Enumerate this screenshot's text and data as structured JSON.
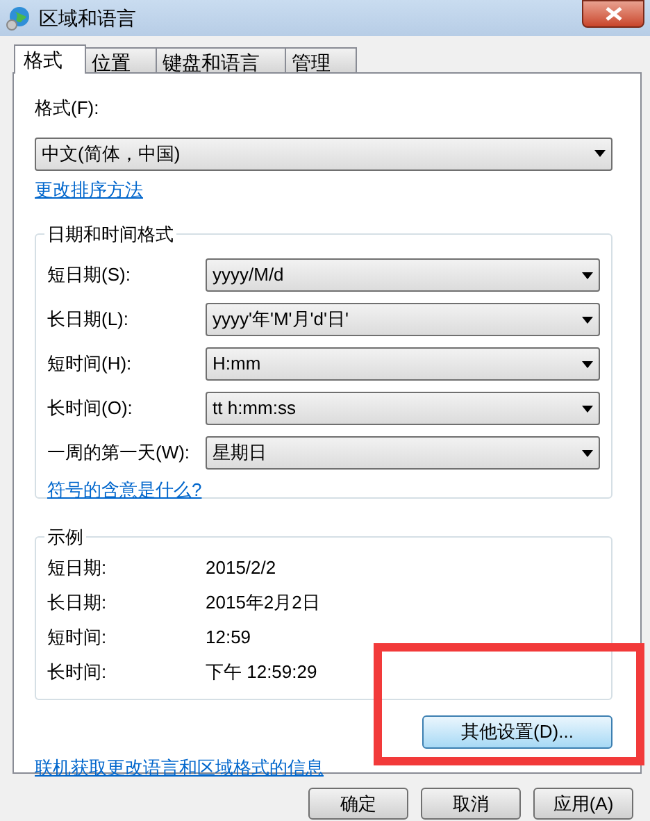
{
  "window": {
    "title": "区域和语言"
  },
  "tabs": [
    {
      "label": "格式",
      "selected": true
    },
    {
      "label": "位置",
      "selected": false
    },
    {
      "label": "键盘和语言",
      "selected": false
    },
    {
      "label": "管理",
      "selected": false
    }
  ],
  "format": {
    "label": "格式(F):",
    "value": "中文(简体，中国)",
    "link": "更改排序方法"
  },
  "date_time_formats": {
    "title": "日期和时间格式",
    "rows": [
      {
        "label": "短日期(S):",
        "value": "yyyy/M/d"
      },
      {
        "label": "长日期(L):",
        "value": "yyyy'年'M'月'd'日'"
      },
      {
        "label": "短时间(H):",
        "value": "H:mm"
      },
      {
        "label": "长时间(O):",
        "value": "tt h:mm:ss"
      },
      {
        "label": "一周的第一天(W):",
        "value": "星期日"
      }
    ],
    "link": "符号的含意是什么?"
  },
  "examples": {
    "title": "示例",
    "rows": [
      {
        "label": "短日期:",
        "value": "2015/2/2"
      },
      {
        "label": "长日期:",
        "value": "2015年2月2日"
      },
      {
        "label": "短时间:",
        "value": "12:59"
      },
      {
        "label": "长时间:",
        "value": "下午 12:59:29"
      }
    ]
  },
  "additional_settings_button": "其他设置(D)...",
  "online_link": "联机获取更改语言和区域格式的信息",
  "buttons": [
    "确定",
    "取消",
    "应用(A)"
  ]
}
